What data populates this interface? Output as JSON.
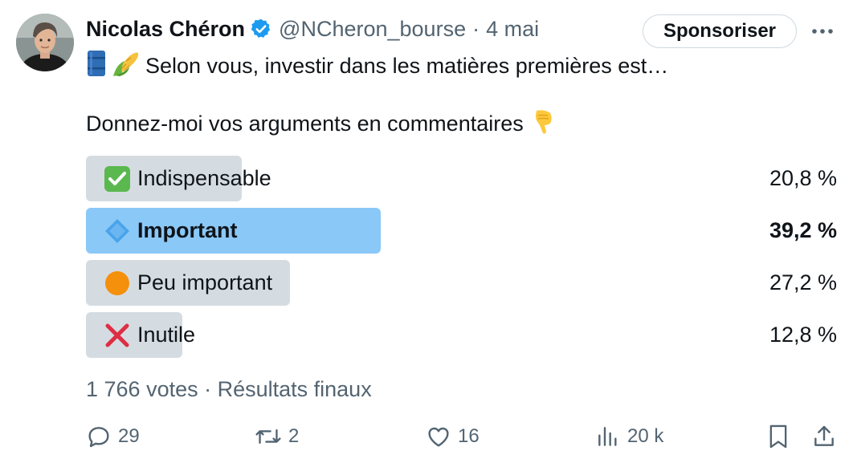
{
  "author": {
    "name": "Nicolas Chéron",
    "handle": "@NCheron_bourse",
    "separator": "·",
    "date": "4 mai"
  },
  "header": {
    "sponsor_label": "Sponsoriser"
  },
  "tweet": {
    "line1_emojis": [
      "oil-barrel-emoji",
      "corn-emoji"
    ],
    "line1": "Selon vous, investir dans les matières premières est…",
    "line2": "Donnez-moi vos arguments en commentaires",
    "line2_emoji": "pointing-down-emoji"
  },
  "poll": {
    "options": [
      {
        "icon": "check-mark-emoji",
        "label": "Indispensable",
        "percent_text": "20,8 %",
        "percent": 20.8,
        "winner": false
      },
      {
        "icon": "blue-diamond-emoji",
        "label": "Important",
        "percent_text": "39,2 %",
        "percent": 39.2,
        "winner": true
      },
      {
        "icon": "orange-circle-emoji",
        "label": "Peu important",
        "percent_text": "27,2 %",
        "percent": 27.2,
        "winner": false
      },
      {
        "icon": "cross-mark-emoji",
        "label": "Inutile",
        "percent_text": "12,8 %",
        "percent": 12.8,
        "winner": false
      }
    ],
    "footer": "1 766 votes · Résultats finaux"
  },
  "actions": {
    "replies": "29",
    "retweets": "2",
    "likes": "16",
    "views": "20 k"
  },
  "colors": {
    "text_primary": "#0f1419",
    "text_secondary": "#536471",
    "poll_bar": "#d5dce1",
    "poll_bar_winner": "#8ac8f8",
    "verified": "#1d9bf0"
  }
}
